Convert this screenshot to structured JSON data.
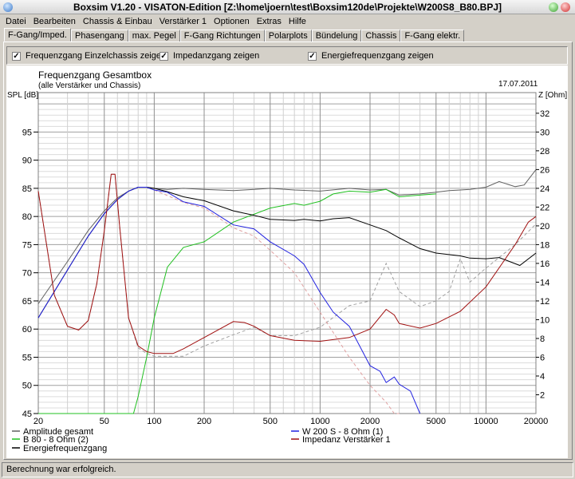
{
  "window": {
    "title": "Boxsim V1.20 - VISATON-Edition [Z:\\home\\joern\\test\\Boxsim120de\\Projekte\\W200S8_B80.BPJ]"
  },
  "menu": [
    "Datei",
    "Bearbeiten",
    "Chassis & Einbau",
    "Verstärker 1",
    "Optionen",
    "Extras",
    "Hilfe"
  ],
  "tabs": [
    {
      "label": "F-Gang/Imped.",
      "active": true
    },
    {
      "label": "Phasengang"
    },
    {
      "label": "max. Pegel"
    },
    {
      "label": "F-Gang Richtungen"
    },
    {
      "label": "Polarplots"
    },
    {
      "label": "Bündelung"
    },
    {
      "label": "Chassis"
    },
    {
      "label": "F-Gang elektr."
    }
  ],
  "options": [
    {
      "label": "Frequenzgang Einzelchassis zeigen",
      "checked": true
    },
    {
      "label": "Impedanzgang zeigen",
      "checked": true
    },
    {
      "label": "Energiefrequenzgang zeigen",
      "checked": true
    }
  ],
  "status": "Berechnung war erfolgreich.",
  "chart_data": {
    "type": "line",
    "title": "Frequenzgang Gesamtbox",
    "subtitle": "(alle Verstärker und Chassis)",
    "date": "17.07.2011",
    "ylabel": "SPL [dB]",
    "y2label": "Z [Ohm]",
    "xscale": "log",
    "xlim": [
      20,
      20000
    ],
    "ylim": [
      45,
      102
    ],
    "y2lim": [
      0,
      34.2
    ],
    "xticks": [
      {
        "v": 20,
        "l": "20"
      },
      {
        "v": 50,
        "l": "50"
      },
      {
        "v": 100,
        "l": "100"
      },
      {
        "v": 200,
        "l": "200"
      },
      {
        "v": 500,
        "l": "500"
      },
      {
        "v": 1000,
        "l": "1000"
      },
      {
        "v": 2000,
        "l": "2000"
      },
      {
        "v": 5000,
        "l": "5000"
      },
      {
        "v": 10000,
        "l": "10000"
      },
      {
        "v": 20000,
        "l": "20000"
      }
    ],
    "yticks": [
      45,
      50,
      55,
      60,
      65,
      70,
      75,
      80,
      85,
      90,
      95
    ],
    "y2ticks": [
      2,
      4,
      6,
      8,
      10,
      12,
      14,
      16,
      18,
      20,
      22,
      24,
      26,
      28,
      30,
      32
    ],
    "grid": true,
    "series": [
      {
        "name": "Amplitude gesamt",
        "color": "#606060",
        "axis": "left",
        "x": [
          20,
          30,
          40,
          50,
          60,
          70,
          80,
          90,
          100,
          120,
          150,
          200,
          300,
          400,
          500,
          700,
          1000,
          1500,
          2000,
          2500,
          3000,
          4000,
          5000,
          6000,
          7000,
          8000,
          10000,
          12000,
          15000,
          17000,
          20000
        ],
        "y": [
          64.5,
          72,
          77.5,
          81,
          83.3,
          84.5,
          85.2,
          85.2,
          85,
          84.8,
          85,
          84.8,
          84.6,
          84.8,
          85,
          84.7,
          84.5,
          85,
          84.7,
          84.8,
          83.8,
          84,
          84.3,
          84.6,
          84.7,
          84.8,
          85.2,
          86.2,
          85.3,
          85.6,
          88.3
        ]
      },
      {
        "name": "B 80 - 8 Ohm (2)",
        "color": "#20c020",
        "axis": "left",
        "x": [
          20,
          70,
          75,
          80,
          90,
          100,
          120,
          150,
          200,
          300,
          500,
          700,
          800,
          1000,
          1200,
          1500,
          2000,
          2500,
          3000,
          4000,
          5000
        ],
        "y": [
          45,
          45,
          45,
          48,
          55,
          62,
          71,
          74.5,
          75.5,
          79,
          81.5,
          82.3,
          82,
          82.7,
          84,
          84.5,
          84.3,
          84.8,
          83.5,
          83.8,
          84
        ]
      },
      {
        "name": "Energiefrequenzgang",
        "color": "#000000",
        "axis": "left",
        "x": [
          20,
          30,
          40,
          50,
          60,
          70,
          80,
          90,
          100,
          120,
          150,
          200,
          300,
          400,
          500,
          700,
          800,
          1000,
          1200,
          1500,
          2000,
          2500,
          3000,
          4000,
          5000,
          7000,
          8000,
          10000,
          12000,
          16000,
          20000
        ],
        "y": [
          62,
          70.5,
          76.5,
          80.5,
          83,
          84.5,
          85.2,
          85.2,
          85,
          84.4,
          83.5,
          82.8,
          81,
          80.2,
          79.5,
          79.3,
          79.5,
          79.2,
          79.6,
          79.8,
          78.5,
          77.5,
          76.2,
          74.3,
          73.5,
          73,
          72.6,
          72.5,
          72.7,
          71.3,
          73.5
        ]
      },
      {
        "name": "W 200 S - 8 Ohm (1)",
        "color": "#2020e0",
        "axis": "left",
        "x": [
          20,
          30,
          40,
          50,
          60,
          70,
          80,
          90,
          100,
          120,
          150,
          200,
          300,
          400,
          500,
          700,
          800,
          1000,
          1200,
          1500,
          2000,
          2300,
          2500,
          2800,
          3000,
          3500,
          4000
        ],
        "y": [
          62,
          70.5,
          76.5,
          80.5,
          83,
          84.5,
          85.2,
          85.2,
          84.7,
          84.3,
          82.6,
          81.8,
          78.5,
          77.8,
          75.5,
          73,
          71.5,
          66.5,
          63,
          60.5,
          53.5,
          52.5,
          50.5,
          51.5,
          50.2,
          49,
          45
        ]
      },
      {
        "name": "Impedanz Verstärker 1",
        "color": "#a01010",
        "axis": "right",
        "x": [
          20,
          25,
          30,
          35,
          40,
          45,
          50,
          55,
          58,
          62,
          70,
          80,
          90,
          100,
          130,
          150,
          200,
          300,
          350,
          400,
          500,
          700,
          1000,
          1500,
          2000,
          2500,
          2800,
          3000,
          4000,
          5000,
          7000,
          10000,
          15000,
          18000,
          20000
        ],
        "y": [
          23.7,
          12.6,
          9.3,
          8.9,
          9.9,
          13.8,
          19.5,
          25.5,
          25.5,
          19.8,
          10.2,
          7.2,
          6.6,
          6.4,
          6.4,
          6.9,
          8.1,
          9.8,
          9.7,
          9.3,
          8.3,
          7.8,
          7.7,
          8.1,
          9,
          11.1,
          10.5,
          9.6,
          9.1,
          9.6,
          10.9,
          13.5,
          18,
          20.4,
          21
        ]
      }
    ],
    "reference_curves": [
      {
        "color": "#a0a0a0",
        "dashed": true,
        "axis": "right",
        "x": [
          20,
          25,
          30,
          35,
          40,
          45,
          50,
          55,
          58,
          62,
          70,
          80,
          90,
          100,
          150,
          200,
          300,
          400,
          500,
          700,
          1000,
          1500,
          2000,
          2500,
          3000,
          4000,
          5000,
          6000,
          7000,
          8000,
          10000,
          15000,
          20000
        ],
        "y": [
          23.7,
          12.6,
          9.3,
          8.9,
          9.9,
          13.8,
          19.5,
          25.5,
          25.5,
          19.8,
          10.2,
          7,
          6.4,
          6.1,
          6.1,
          7.2,
          8.4,
          9.2,
          8.3,
          8.3,
          9.2,
          11.5,
          12,
          16,
          13,
          11.4,
          12,
          13,
          16.5,
          14,
          15.5,
          18,
          20.2
        ]
      },
      {
        "color": "#e0a0a0",
        "dashed": true,
        "axis": "left",
        "x": [
          100,
          150,
          200,
          300,
          400,
          500,
          700,
          1000,
          1500,
          2000,
          2500,
          2800,
          3000
        ],
        "y": [
          84.7,
          82.5,
          81.5,
          78,
          76.5,
          74,
          70,
          63,
          55,
          50,
          47,
          45,
          45
        ]
      }
    ]
  }
}
